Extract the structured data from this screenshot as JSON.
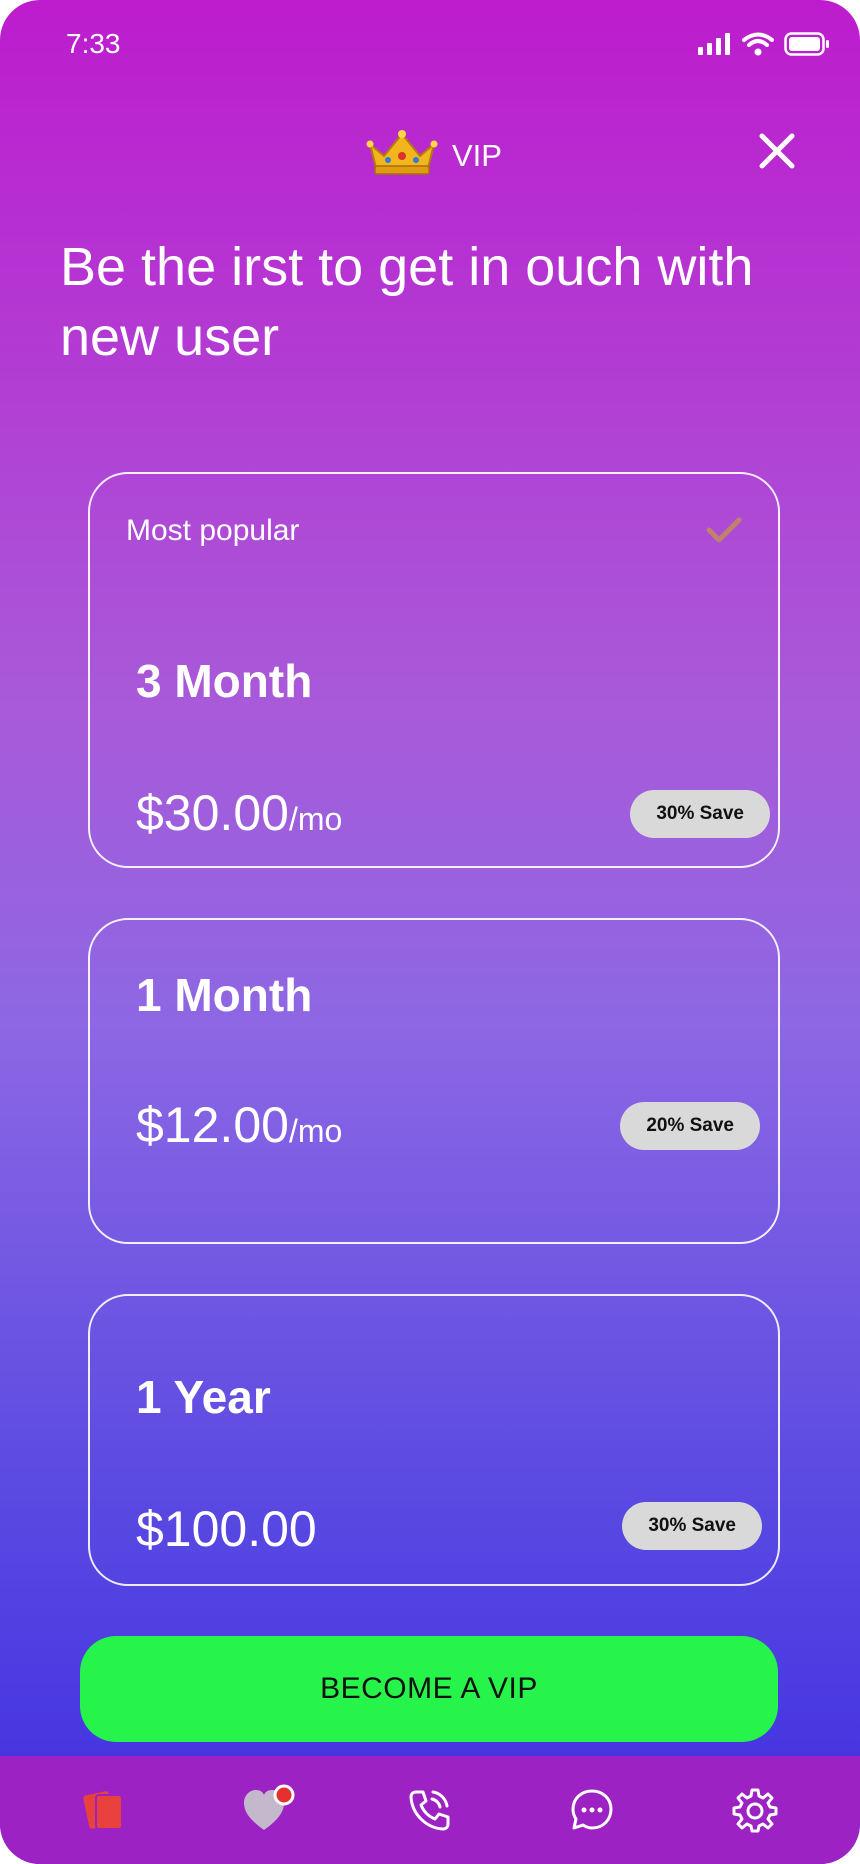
{
  "status_bar": {
    "time": "7:33",
    "icons": [
      "signal-icon",
      "wifi-icon",
      "battery-icon"
    ]
  },
  "header": {
    "icon": "crown-icon",
    "title": "VIP",
    "close_icon": "close-icon"
  },
  "headline": "Be the irst to get in ouch with new user",
  "plans": [
    {
      "badge_label": "Most popular",
      "selected": true,
      "name": "3 Month",
      "price": "$30.00",
      "period": "/mo",
      "save": "30% Save"
    },
    {
      "name": "1 Month",
      "price": "$12.00",
      "period": "/mo",
      "save": "20% Save"
    },
    {
      "name": "1 Year",
      "price": "$100.00",
      "period": "",
      "save": "30% Save"
    }
  ],
  "cta": {
    "label": "BECOME A VIP"
  },
  "bottom_nav": {
    "items": [
      {
        "icon": "cards-icon"
      },
      {
        "icon": "heart-icon",
        "has_notification": true
      },
      {
        "icon": "phone-call-icon"
      },
      {
        "icon": "chat-icon"
      },
      {
        "icon": "settings-icon"
      }
    ]
  },
  "colors": {
    "gradient_top": "#bd1ccd",
    "gradient_bottom": "#3f2ee0",
    "cta_green": "#27f44a",
    "nav_background": "#9d22c3",
    "badge_gray": "#d9d9d9",
    "check_color": "#c0826a",
    "cards_icon_red": "#e8413e",
    "notification_red": "#e53030"
  }
}
